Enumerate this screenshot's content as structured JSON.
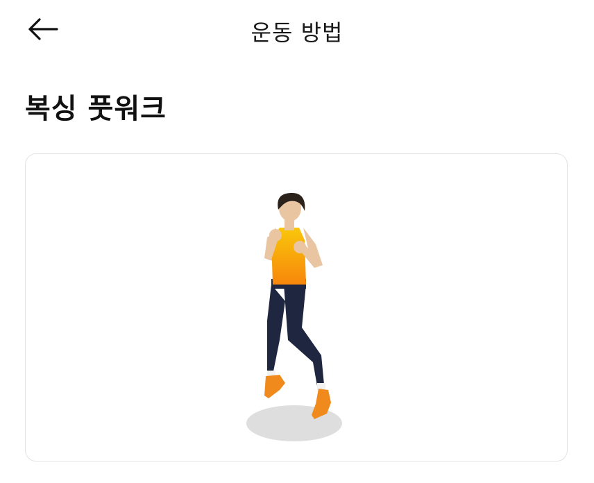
{
  "header": {
    "back_icon": "arrow-left-icon",
    "title": "운동 방법"
  },
  "exercise": {
    "name": "복싱 풋워크",
    "illustration": "boxing-footwork-figure"
  },
  "colors": {
    "tank_top_top": "#f9c70b",
    "tank_top_bottom": "#f7860b",
    "leggings": "#1f2640",
    "shoes": "#f08a1c",
    "skin": "#e9c5a2",
    "hair": "#2c221c",
    "shadow": "#dedede",
    "card_border": "#e3e3e3"
  }
}
